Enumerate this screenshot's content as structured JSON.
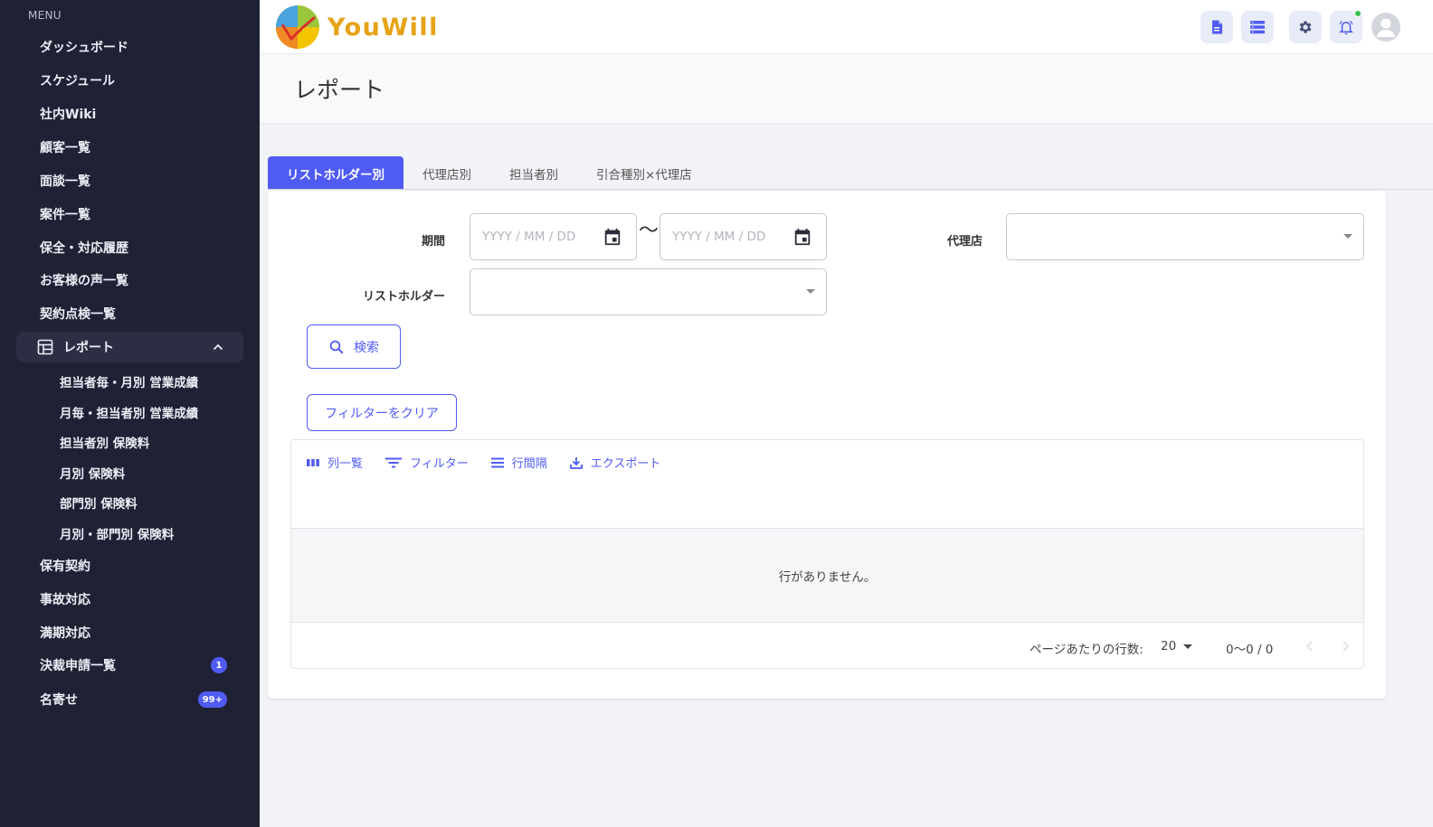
{
  "sidebar": {
    "caption": "MENU",
    "items": [
      {
        "label": "ダッシュボード"
      },
      {
        "label": "スケジュール"
      },
      {
        "label": "社内Wiki"
      },
      {
        "label": "顧客一覧"
      },
      {
        "label": "面談一覧"
      },
      {
        "label": "案件一覧"
      },
      {
        "label": "保全・対応履歴"
      },
      {
        "label": "お客様の声一覧"
      },
      {
        "label": "契約点検一覧"
      },
      {
        "label": "レポート"
      },
      {
        "label": "保有契約"
      },
      {
        "label": "事故対応"
      },
      {
        "label": "満期対応"
      },
      {
        "label": "決裁申請一覧",
        "badge": "1"
      },
      {
        "label": "名寄せ",
        "badge": "99+"
      }
    ],
    "report_sub": [
      {
        "label": "担当者毎・月別 営業成績"
      },
      {
        "label": "月毎・担当者別 営業成績"
      },
      {
        "label": "担当者別 保険料"
      },
      {
        "label": "月別 保険料"
      },
      {
        "label": "部門別 保険料"
      },
      {
        "label": "月別・部門別 保険料"
      }
    ]
  },
  "header": {
    "logo_text": "YouWill"
  },
  "page": {
    "title": "レポート"
  },
  "tabs": [
    {
      "label": "リストホルダー別",
      "active": true
    },
    {
      "label": "代理店別"
    },
    {
      "label": "担当者別"
    },
    {
      "label": "引合種別×代理店"
    }
  ],
  "filters": {
    "period_label": "期間",
    "date_placeholder_from": "YYYY / MM / DD",
    "date_placeholder_to": "YYYY / MM / DD",
    "range_sep": "〜",
    "agency_label": "代理店",
    "listholder_label": "リストホルダー",
    "search_label": "検索",
    "clear_label": "フィルターをクリア"
  },
  "grid": {
    "toolbar": {
      "columns": "列一覧",
      "filter": "フィルター",
      "density": "行間隔",
      "export": "エクスポート"
    },
    "empty_text": "行がありません。",
    "rows_per_page_label": "ページあたりの行数:",
    "rows_per_page_value": "20",
    "range_text": "0〜0 / 0"
  },
  "colors": {
    "sidebar_bg": "#1f2235",
    "accent": "#4f5bf2",
    "logo_orange": "#e6a317",
    "status_green": "#37c24a"
  }
}
